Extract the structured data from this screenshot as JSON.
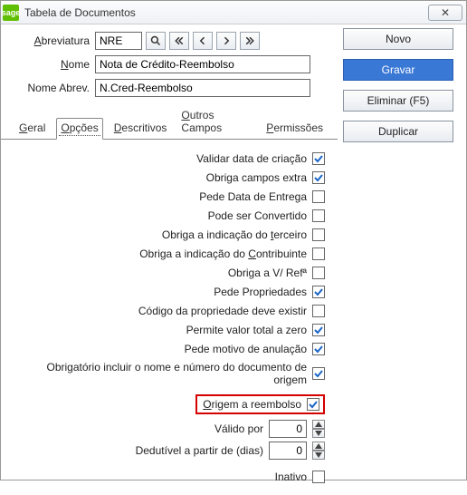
{
  "window": {
    "logo": "sage",
    "title": "Tabela de Documentos",
    "close_glyph": "✕"
  },
  "form": {
    "abrev_label_pre": "A",
    "abrev_label_rest": "breviatura",
    "abrev_value": "NRE",
    "nome_label_pre": "N",
    "nome_label_rest": "ome",
    "nome_value": "Nota de Crédito-Reembolso",
    "nomeab_label": "Nome Abrev.",
    "nomeab_value": "N.Cred-Reembolso"
  },
  "tabs": {
    "geral_pre": "G",
    "geral_rest": "eral",
    "opcoes_pre": "O",
    "opcoes_rest": "pções",
    "descr_pre": "D",
    "descr_rest": "escritivos",
    "outros_pre": "O",
    "outros_rest": "utros Campos",
    "perm_pre": "P",
    "perm_rest": "ermissões"
  },
  "opts": {
    "validar": "Validar data de criação",
    "obriga_extra": "Obriga campos extra",
    "pede_data": "Pede Data de Entrega",
    "pode_conv": "Pode ser Convertido",
    "obriga_terc_pre": "Obriga a indicação do ",
    "obriga_terc_u": "t",
    "obriga_terc_rest": "erceiro",
    "obriga_ctr_pre": "Obriga a indicação do ",
    "obriga_ctr_u": "C",
    "obriga_ctr_rest": "ontribuinte",
    "obriga_vref": "Obriga a V/ Refª",
    "pede_prop": "Pede Propriedades",
    "cod_prop": "Código da propriedade deve existir",
    "permite_zero": "Permite valor total a zero",
    "pede_motivo": "Pede motivo de anulação",
    "obrig_origem": "Obrigatório incluir o nome e número do documento de origem",
    "origem_reemb_u": "O",
    "origem_reemb_rest": "rigem a reembolso",
    "valido_por": "Válido por",
    "valido_val": "0",
    "dedutivel": "Dedutível a partir de (dias)",
    "dedutivel_val": "0",
    "inativo": "Inativo"
  },
  "checked": {
    "validar": true,
    "obriga_extra": true,
    "pede_data": false,
    "pode_conv": false,
    "obriga_terc": false,
    "obriga_ctr": false,
    "obriga_vref": false,
    "pede_prop": true,
    "cod_prop": false,
    "permite_zero": true,
    "pede_motivo": true,
    "obrig_origem": true,
    "origem_reemb": true,
    "inativo": false
  },
  "buttons": {
    "novo": "Novo",
    "gravar": "Gravar",
    "eliminar": "Eliminar (F5)",
    "duplicar": "Duplicar"
  }
}
